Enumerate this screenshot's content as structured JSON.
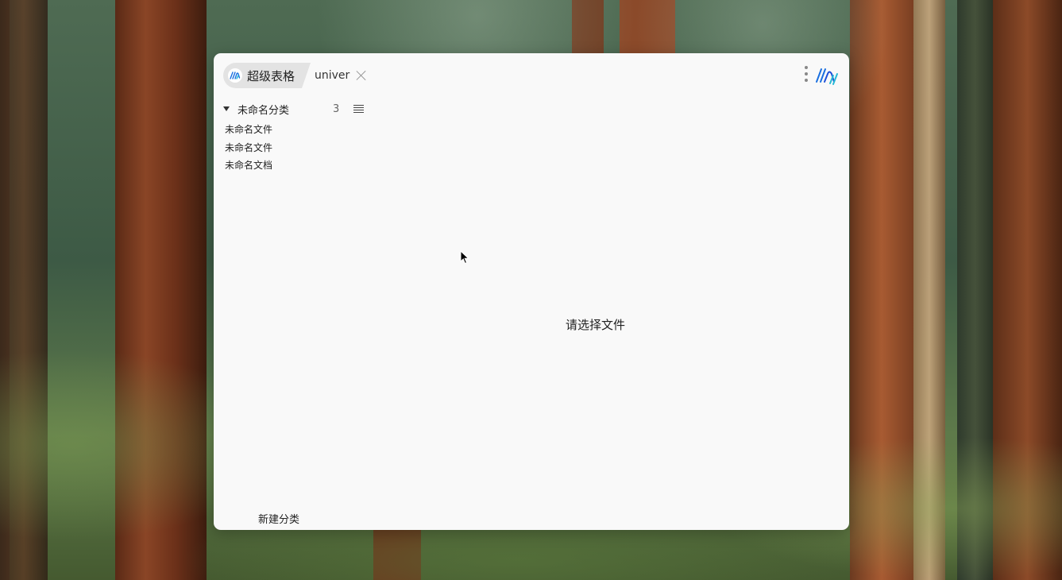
{
  "window": {
    "tabs": [
      {
        "label": "超级表格",
        "active": true,
        "icon": "univer-logo-icon"
      },
      {
        "label": "univer",
        "active": false
      }
    ],
    "menu_icon": "more-vertical-icon",
    "brand_icon": "univer-logo-icon"
  },
  "sidebar": {
    "category": {
      "label": "未命名分类",
      "count": "3",
      "expanded": true
    },
    "files": [
      {
        "label": "未命名文件"
      },
      {
        "label": "未命名文件"
      },
      {
        "label": "未命名文档"
      }
    ],
    "new_category_label": "新建分类"
  },
  "main": {
    "empty_prompt": "请选择文件"
  },
  "colors": {
    "window_bg": "#f9f9f9",
    "active_tab_bg": "#e3e3e3",
    "brand_blue": "#1a6fe0",
    "brand_cyan": "#27b9d6"
  }
}
